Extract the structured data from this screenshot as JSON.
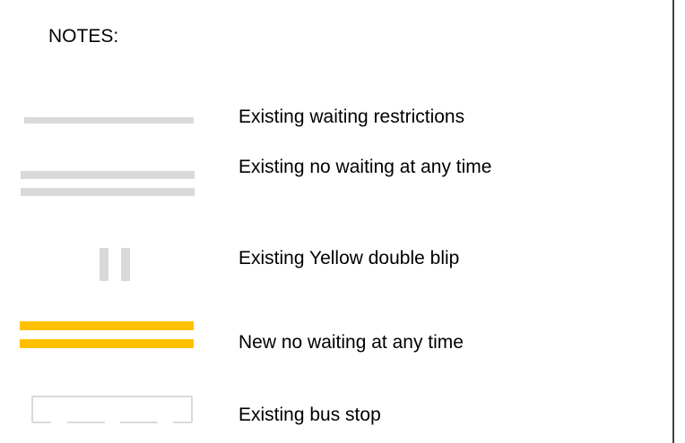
{
  "legend": {
    "title": "NOTES:",
    "items": [
      {
        "key": "existing-waiting-restrictions",
        "label": "Existing waiting restrictions",
        "symbol": "single-line",
        "color": "#d9d9d9"
      },
      {
        "key": "existing-no-waiting",
        "label": "Existing no waiting at any time",
        "symbol": "double-line",
        "color": "#d9d9d9"
      },
      {
        "key": "existing-yellow-double-blip",
        "label": "Existing Yellow double blip",
        "symbol": "double-blip",
        "color": "#d9d9d9"
      },
      {
        "key": "new-no-waiting",
        "label": "New no waiting at any time",
        "symbol": "double-line",
        "color": "#ffc000"
      },
      {
        "key": "existing-bus-stop",
        "label": "Existing bus stop",
        "symbol": "bus-stop-box",
        "color": "#d9d9d9"
      }
    ]
  }
}
